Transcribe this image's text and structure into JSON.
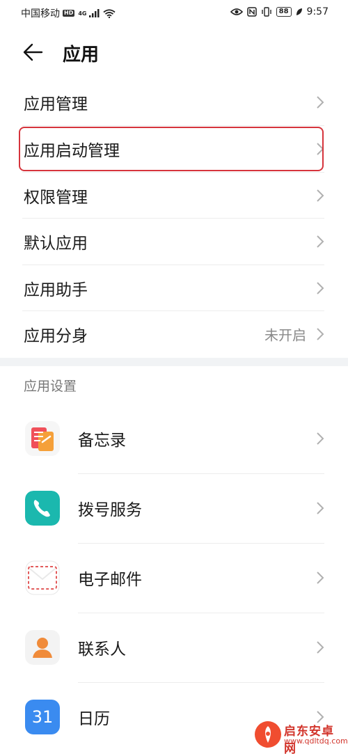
{
  "status_bar": {
    "carrier": "中国移动",
    "hd_badge": "HD",
    "network": "4G",
    "battery": "88",
    "time": "9:57"
  },
  "header": {
    "title": "应用"
  },
  "menu": [
    {
      "label": "应用管理",
      "value": ""
    },
    {
      "label": "应用启动管理",
      "value": ""
    },
    {
      "label": "权限管理",
      "value": ""
    },
    {
      "label": "默认应用",
      "value": ""
    },
    {
      "label": "应用助手",
      "value": ""
    },
    {
      "label": "应用分身",
      "value": "未开启"
    }
  ],
  "app_settings": {
    "section_title": "应用设置",
    "apps": [
      {
        "name": "备忘录",
        "icon": "memo-icon"
      },
      {
        "name": "拨号服务",
        "icon": "phone-icon"
      },
      {
        "name": "电子邮件",
        "icon": "mail-icon"
      },
      {
        "name": "联系人",
        "icon": "contacts-icon"
      },
      {
        "name": "日历",
        "icon": "calendar-icon",
        "icon_text": "31"
      }
    ]
  },
  "watermark": {
    "line1": "启东安卓网",
    "line2": "www.qdltdq.com"
  },
  "colors": {
    "highlight": "#d6343c",
    "divider": "#ececec",
    "secondary_text": "#8a8a8a"
  }
}
